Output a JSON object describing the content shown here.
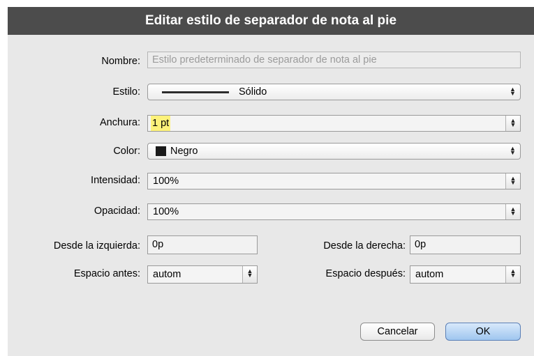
{
  "dialog": {
    "title": "Editar estilo de separador de nota al pie",
    "name": {
      "label": "Nombre:",
      "value": "Estilo predeterminado de separador de nota al pie"
    },
    "style": {
      "label": "Estilo:",
      "value": "Sólido"
    },
    "width": {
      "label": "Anchura:",
      "value": "1 pt"
    },
    "color": {
      "label": "Color:",
      "value": "Negro",
      "swatch": "#1a1a1a"
    },
    "intensity": {
      "label": "Intensidad:",
      "value": "100%"
    },
    "opacity": {
      "label": "Opacidad:",
      "value": "100%"
    },
    "left_offset": {
      "label": "Desde la izquierda:",
      "value": "0p"
    },
    "right_offset": {
      "label": "Desde la derecha:",
      "value": "0p"
    },
    "space_before": {
      "label": "Espacio antes:",
      "value": "autom"
    },
    "space_after": {
      "label": "Espacio después:",
      "value": "autom"
    },
    "cancel_label": "Cancelar",
    "ok_label": "OK"
  }
}
